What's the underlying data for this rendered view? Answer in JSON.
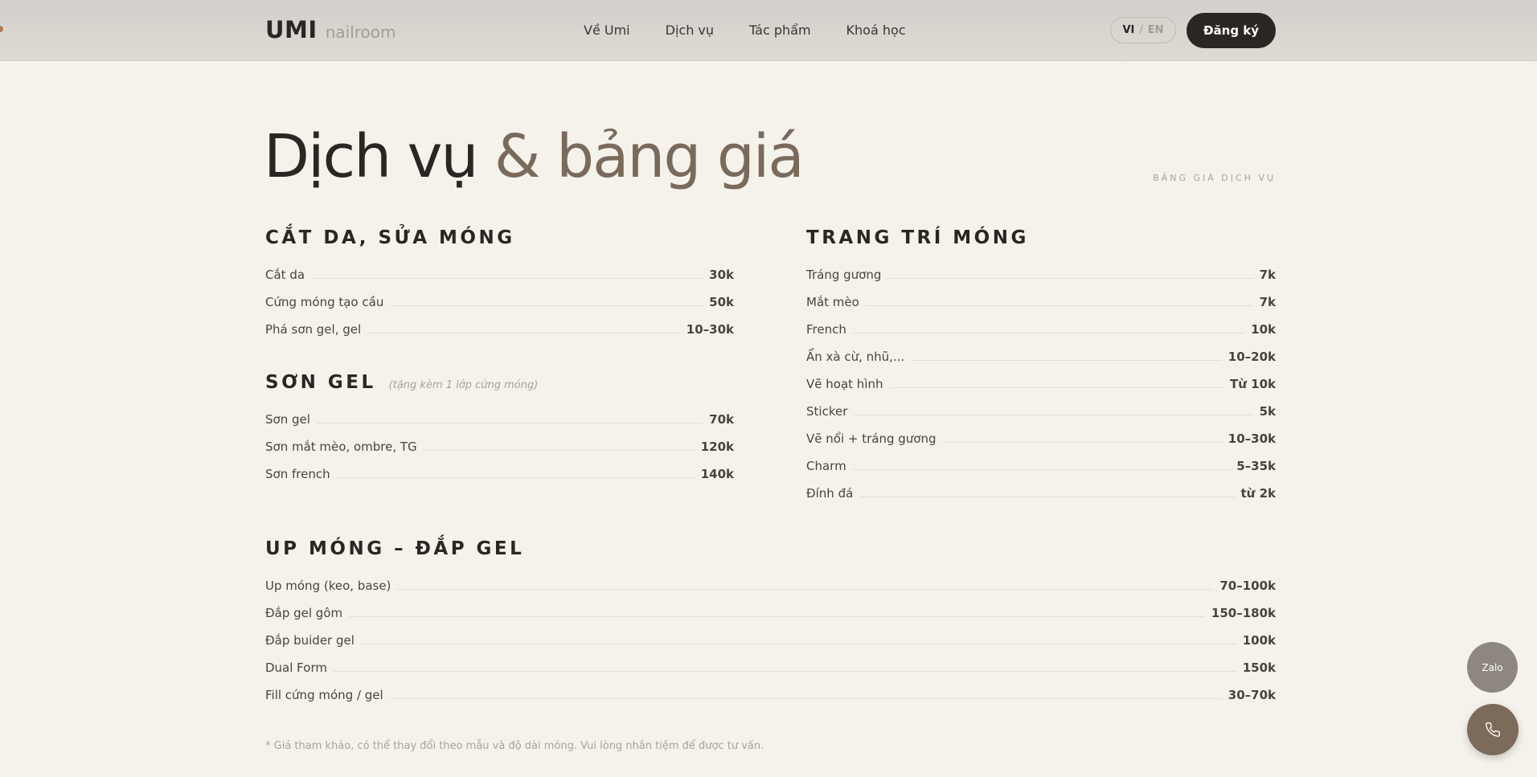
{
  "header": {
    "logo_main": "UMI",
    "logo_sub": "nailroom",
    "nav": [
      "Về Umi",
      "Dịch vụ",
      "Tác phẩm",
      "Khoá học"
    ],
    "lang_vi": "VI",
    "lang_sep": "/",
    "lang_en": "EN",
    "register_label": "Đăng ký"
  },
  "hero": {
    "title_part1": "Dịch vụ",
    "title_part2": "& bảng giá",
    "eyebrow": "BẢNG GIÁ DỊCH VỤ"
  },
  "sections": {
    "cat_da": {
      "title": "CẮT DA, SỬA MÓNG",
      "items": [
        {
          "name": "Cắt da",
          "price": "30k"
        },
        {
          "name": "Cứng móng tạo cầu",
          "price": "50k"
        },
        {
          "name": "Phá sơn gel, gel",
          "price": "10–30k"
        }
      ]
    },
    "son_gel": {
      "title": "SƠN GEL",
      "note": "(tặng kèm 1 lớp cứng móng)",
      "items": [
        {
          "name": "Sơn gel",
          "price": "70k"
        },
        {
          "name": "Sơn mắt mèo, ombre, TG",
          "price": "120k"
        },
        {
          "name": "Sơn french",
          "price": "140k"
        }
      ]
    },
    "trang_tri": {
      "title": "TRANG TRÍ MÓNG",
      "items": [
        {
          "name": "Tráng gương",
          "price": "7k"
        },
        {
          "name": "Mắt mèo",
          "price": "7k"
        },
        {
          "name": "French",
          "price": "10k"
        },
        {
          "name": "Ẩn xà cừ, nhũ,...",
          "price": "10–20k"
        },
        {
          "name": "Vẽ hoạt hình",
          "price": "Từ 10k"
        },
        {
          "name": "Sticker",
          "price": "5k"
        },
        {
          "name": "Vẽ nổi + tráng gương",
          "price": "10–30k"
        },
        {
          "name": "Charm",
          "price": "5–35k"
        },
        {
          "name": "Đính đá",
          "price": "từ 2k"
        }
      ]
    },
    "up_mong": {
      "title": "UP MÓNG – ĐẮP GEL",
      "items": [
        {
          "name": "Up móng (keo, base)",
          "price": "70–100k"
        },
        {
          "name": "Đắp gel gôm",
          "price": "150–180k"
        },
        {
          "name": "Đắp buider gel",
          "price": "100k"
        },
        {
          "name": "Dual Form",
          "price": "150k"
        },
        {
          "name": "Fill cứng móng / gel",
          "price": "30–70k"
        }
      ]
    }
  },
  "footnote": "* Giá tham khảo, có thể thay đổi theo mẫu và độ dài móng. Vui lòng nhắn tiệm để được tư vấn.",
  "floating": {
    "zalo_label": "Zalo",
    "phone_icon": "phone-icon"
  },
  "colors": {
    "background": "#f5f2ec",
    "accent": "#7a6a5c",
    "dark": "#2a2622"
  }
}
